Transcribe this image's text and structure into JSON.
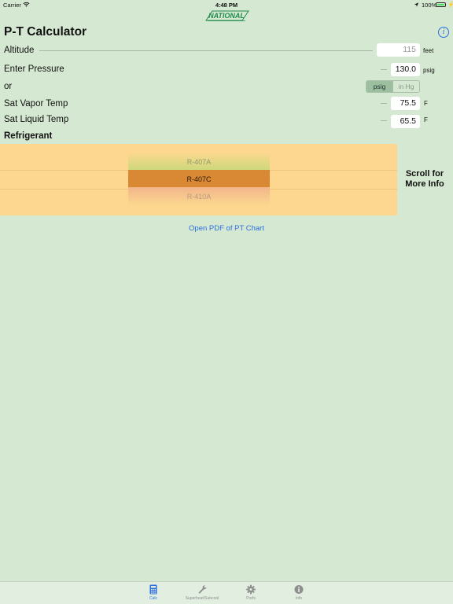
{
  "status_bar": {
    "carrier": "Carrier",
    "time": "4:48 PM",
    "battery_percent": "100%",
    "battery_level": 1.0
  },
  "header": {
    "logo_text": "NATIONAL",
    "title": "P-T Calculator",
    "info_symbol": "i"
  },
  "form": {
    "altitude": {
      "label": "Altitude",
      "value": "115",
      "unit": "feet"
    },
    "pressure": {
      "label": "Enter Pressure",
      "value": "130.0",
      "unit": "psig"
    },
    "unit_toggle": {
      "label": "or",
      "options": [
        "psig",
        "in Hg"
      ],
      "selected": "psig"
    },
    "vapor_temp": {
      "label": "Sat Vapor Temp",
      "value": "75.5",
      "unit": "F"
    },
    "liquid_temp": {
      "label": "Sat Liquid Temp",
      "value": "65.5",
      "unit": "F"
    },
    "refrigerant": {
      "label": "Refrigerant",
      "options": [
        "R-407A",
        "R-407C",
        "R-410A"
      ],
      "selected": "R-407C"
    },
    "scroll_hint": "Scroll for More Info",
    "pdf_link": "Open PDF of PT Chart"
  },
  "colors": {
    "background": "#d5e8d1",
    "accent": "#2b6fe0",
    "picker_background": "#fdd68f",
    "picker_selected": "#d98834",
    "logo_green": "#1f8a4c"
  },
  "tabs": [
    {
      "label": "Calc",
      "icon": "calculator-icon",
      "active": true
    },
    {
      "label": "Superheat/Subcool",
      "icon": "wrench-icon",
      "active": false
    },
    {
      "label": "Prefs",
      "icon": "gear-icon",
      "active": false
    },
    {
      "label": "Info",
      "icon": "info-icon",
      "active": false
    }
  ]
}
